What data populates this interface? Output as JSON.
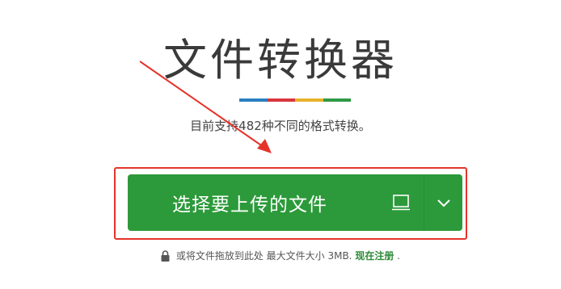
{
  "header": {
    "title": "文件转换器",
    "subtitle": "目前支持482种不同的格式转换。"
  },
  "color_bar": [
    "#2a7fc1",
    "#d9363e",
    "#e8b32c",
    "#2f9a47"
  ],
  "upload": {
    "label": "选择要上传的文件",
    "icon": "device-icon",
    "caret": "chevron-down-icon"
  },
  "note": {
    "icon": "lock-icon",
    "text": "或将文件拖放到此处 最大文件大小 3MB.",
    "link": "现在注册",
    "suffix": "."
  },
  "colors": {
    "button": "#2c9a3a",
    "highlight": "#e5332a",
    "link": "#2c8a36"
  }
}
